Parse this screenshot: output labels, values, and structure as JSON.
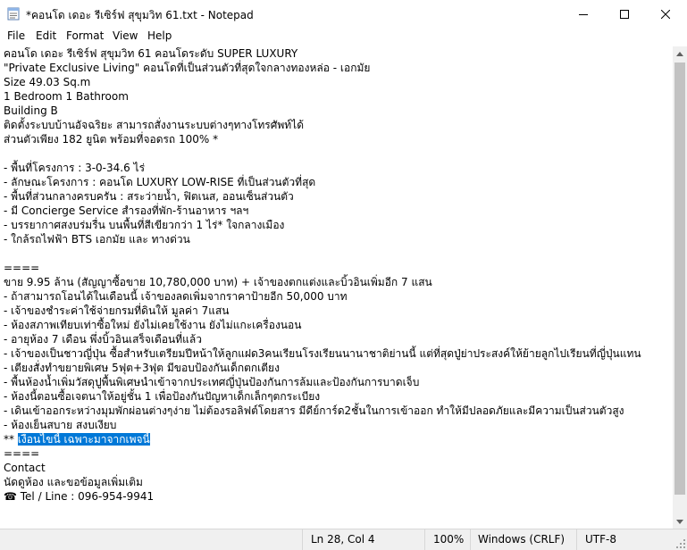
{
  "window": {
    "title": "*คอนโด เดอะ รีเซิร์ฟ สุขุมวิท 61.txt - Notepad"
  },
  "menu": {
    "items": [
      "File",
      "Edit",
      "Format",
      "View",
      "Help"
    ]
  },
  "editor": {
    "lines": [
      "คอนโด เดอะ รีเซิร์ฟ สุขุมวิท 61 คอนโดระดับ SUPER LUXURY",
      "\"Private Exclusive Living\" คอนโดที่เป็นส่วนตัวที่สุดใจกลางทองหล่อ - เอกมัย",
      "Size 49.03 Sq.m",
      "1 Bedroom 1 Bathroom",
      "Building B",
      "ติดตั้งระบบบ้านอัจฉริยะ สามารถสั่งงานระบบต่างๆทางโทรศัพท์ได้",
      "ส่วนตัวเพียง 182 ยูนิต พร้อมที่จอดรถ 100% *",
      "",
      "- พื้นที่โครงการ : 3-0-34.6 ไร่",
      "- ลักษณะโครงการ : คอนโด LUXURY LOW-RISE ที่เป็นส่วนตัวที่สุด",
      "- พื้นที่ส่วนกลางครบครัน : สระว่ายน้ำ, ฟิตเนส, ออนเซ็นส่วนตัว",
      "- มี Concierge Service สำรองที่พัก-ร้านอาหาร ฯลฯ",
      "- บรรยากาศสงบร่มรื่น บนพื้นที่สีเขียวกว่า 1 ไร่* ใจกลางเมือง",
      "- ใกล้รถไฟฟ้า BTS เอกมัย และ ทางด่วน",
      "",
      "",
      "====",
      "ขาย 9.95 ล้าน (สัญญาซื้อขาย 10,780,000 บาท) + เจ้าของตกแต่งและบิ้วอินเพิ่มอีก 7 แสน",
      "- ถ้าสามารถโอนได้ในเดือนนี้ เจ้าของลดเพิ่มจากราคาป้ายอีก 50,000 บาท",
      "- เจ้าของชำระค่าใช้จ่ายกรมที่ดินให้ มูลค่า 7แสน",
      "- ห้องสภาพเทียบเท่าซื้อใหม่ ยังไม่เคยใช้งาน ยังไม่แกะเครื่องนอน",
      "- อายุห้อง 7 เดือน พึ่งบิ้วอินเสร็จเดือนที่แล้ว",
      "- เจ้าของเป็นชาวญี่ปุ่น ซื้อสำหรับเตรียมปีหน้าให้ลูกแฝด3คนเรียนโรงเรียนนานาชาติย่านนี้ แต่ที่สุดปู่ย่าประสงค์ให้ย้ายลูกไปเรียนที่ญี่ปุ่นแทน",
      "- เตียงสั่งทำขยายพิเศษ 5ฟุต+3ฟุต มีขอบป้องกันเด็กตกเตียง",
      "- พื้นห้องน้ำเพิ่มวัสดุปูพื้นพิเศษนำเข้าจากประเทศญี่ปุ่นป้องกันการล้มและป้องกันการบาดเจ็บ",
      "- ห้องนี้ตอนซื้อเจตนาให้อยู่ชั้น 1 เพื่อป้องกันปัญหาเด็กเล็กๆตกระเบียง",
      "- เดินเข้าออกระหว่างมุมพักผ่อนต่างๆง่าย ไม่ต้องรอลิฟต์โดยสาร มีดีย์การ์ด2ชั้นในการเข้าออก ทำให้มีปลอดภัยและมีความเป็นส่วนตัวสูง",
      "- ห้องเย็นสบาย สงบเงียบ",
      "",
      "====",
      "Contact",
      "นัดดูห้อง และขอข้อมูลเพิ่มเติม",
      "☎ Tel / Line : 096-954-9941"
    ],
    "selected_line_prefix": "** ",
    "selected_text": "เงื่อนไขนี้ เฉพาะมาจากเพจนี้"
  },
  "status": {
    "position": "Ln 28, Col 4",
    "zoom": "100%",
    "line_ending": "Windows (CRLF)",
    "encoding": "UTF-8"
  }
}
